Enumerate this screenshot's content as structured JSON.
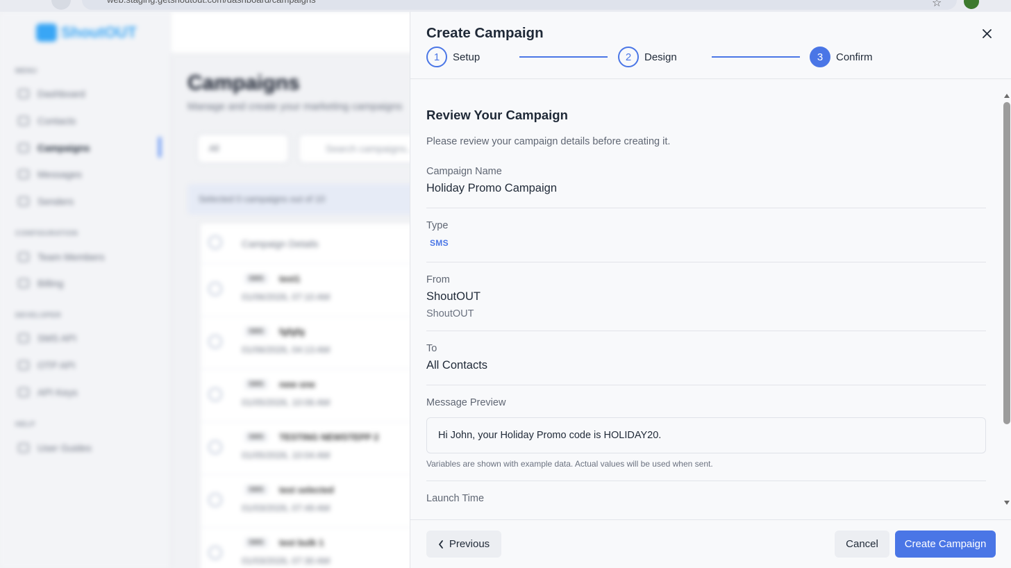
{
  "browser": {
    "url": "web.staging.getshoutout.com/dashboard/campaigns"
  },
  "background": {
    "logo_text": "ShoutOUT",
    "sections": {
      "menu": "MENU",
      "configuration": "CONFIGURATION",
      "developer": "DEVELOPER",
      "help": "HELP"
    },
    "nav": {
      "dashboard": "Dashboard",
      "contacts": "Contacts",
      "campaigns": "Campaigns",
      "messages": "Messages",
      "senders": "Senders",
      "team_members": "Team Members",
      "billing": "Billing",
      "sms_api": "SMS API",
      "otp_api": "OTP API",
      "api_keys": "API Keys",
      "user_guides": "User Guides"
    },
    "page_title": "Campaigns",
    "page_subtitle": "Manage and create your marketing campaigns",
    "filter": "All",
    "search_placeholder": "Search campaigns...",
    "selected_text": "Selected   0   campaigns out of 10",
    "table_header": "Campaign Details",
    "rows": [
      {
        "badge": "SMS",
        "name": "test1",
        "date": "01/06/2026, 07:10 AM"
      },
      {
        "badge": "SMS",
        "name": "fgfgfg",
        "date": "01/06/2026, 04:13 AM"
      },
      {
        "badge": "SMS",
        "name": "new one",
        "date": "01/05/2026, 10:06 AM"
      },
      {
        "badge": "SMS",
        "name": "TESTING NEWSTEPP 2",
        "date": "01/05/2026, 10:04 AM"
      },
      {
        "badge": "SMS",
        "name": "test selected",
        "date": "01/03/2026, 07:49 AM"
      },
      {
        "badge": "SMS",
        "name": "test bulk 1",
        "date": "01/03/2026, 07:30 AM"
      }
    ]
  },
  "drawer": {
    "title": "Create Campaign",
    "steps": [
      {
        "number": "1",
        "label": "Setup"
      },
      {
        "number": "2",
        "label": "Design"
      },
      {
        "number": "3",
        "label": "Confirm"
      }
    ],
    "review": {
      "title": "Review Your Campaign",
      "description": "Please review your campaign details before creating it.",
      "campaign_name_label": "Campaign Name",
      "campaign_name": "Holiday Promo Campaign",
      "type_label": "Type",
      "type": "SMS",
      "from_label": "From",
      "from_name": "ShoutOUT",
      "from_id": "ShoutOUT",
      "to_label": "To",
      "to": "All Contacts",
      "preview_label": "Message Preview",
      "preview_text": "Hi John, your Holiday Promo code is HOLIDAY20.",
      "preview_note": "Variables are shown with example data. Actual values will be used when sent.",
      "launch_time_label": "Launch Time"
    },
    "footer": {
      "previous": "Previous",
      "cancel": "Cancel",
      "create": "Create Campaign"
    }
  },
  "colors": {
    "accent": "#4a76e6",
    "brand": "#39a6f5"
  }
}
